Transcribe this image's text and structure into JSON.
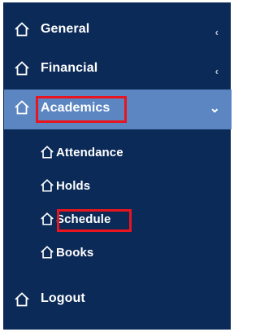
{
  "menu": {
    "general": {
      "label": "General",
      "icon": "home-icon",
      "chevron": "‹"
    },
    "financial": {
      "label": "Financial",
      "icon": "home-icon",
      "chevron": "‹"
    },
    "academics": {
      "label": "Academics",
      "icon": "home-icon",
      "chevron": "⌄",
      "subitems": [
        {
          "label": "Attendance",
          "icon": "home-icon"
        },
        {
          "label": "Holds",
          "icon": "home-icon"
        },
        {
          "label": "Schedule",
          "icon": "home-icon"
        },
        {
          "label": "Books",
          "icon": "home-icon"
        }
      ]
    },
    "logout": {
      "label": "Logout",
      "icon": "home-icon"
    }
  },
  "colors": {
    "sidebar_bg": "#0b2a57",
    "active_bg": "#5c86c2",
    "highlight_border": "#e8141e"
  }
}
